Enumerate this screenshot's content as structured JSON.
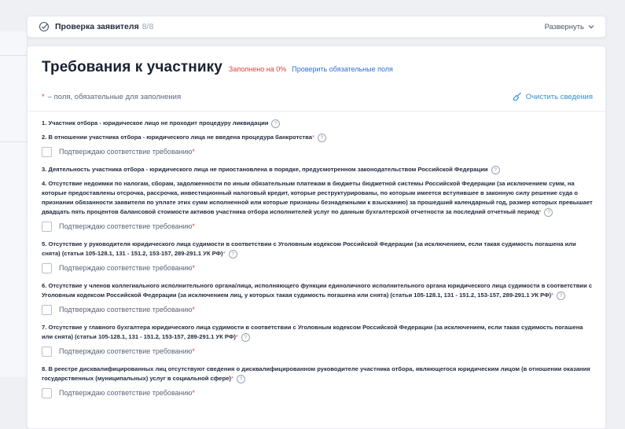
{
  "step": {
    "title": "Проверка заявителя",
    "count": "8/8",
    "expand_label": "Развернуть"
  },
  "section": {
    "title": "Требования к участнику",
    "fill_status": "Заполнено на 0%",
    "check_link": "Проверить обязательные поля"
  },
  "required_note": {
    "star": "*",
    "text": " – поля, обязательные для заполнения",
    "clear_label": "Очистить сведения"
  },
  "confirm_label": "Подтверждаю соответствие требованию",
  "requirements": [
    {
      "text": "1. Участник отбора - юридическое лицо не проходит процедуру ликвидации",
      "required": false,
      "confirm": false
    },
    {
      "text": "2. В отношении участника отбора - юридического лица не введена процедура банкротства",
      "required": true,
      "confirm": true
    },
    {
      "text": "3. Деятельность участника отбора - юридического лица не приостановлена в порядке, предусмотренном законодательством Российской Федерации",
      "required": false,
      "confirm": false
    },
    {
      "text": "4. Отсутствие недоимки по налогам, сборам, задолженности по иным обязательным платежам в бюджеты бюджетной системы Российской Федерации (за исключением сумм, на которые предоставлены отсрочка, рассрочка, инвестиционный налоговый кредит, которые реструктурированы, по которым имеется вступившее в законную силу решение суда о признании обязанности заявителя по уплате этих сумм исполненной или которые признаны безнадежными к взысканию) за прошедший календарный год, размер которых превышает двадцать пять процентов балансовой стоимости активов участника отбора исполнителей услуг по данным бухгалтерской отчетности за последний отчетный период",
      "required": true,
      "confirm": true
    },
    {
      "text": "5. Отсутствие у руководителя юридического лица судимости в соответствии с Уголовным кодексом Российской Федерации (за исключением, если такая судимость погашена или снята) (статьи 105-128.1, 131 - 151.2, 153-157, 289-291.1 УК РФ)",
      "required": true,
      "confirm": true
    },
    {
      "text": "6. Отсутствие у членов коллегиального исполнительного органа/лица, исполняющего функции единоличного исполнительного органа юридического лица судимости в соответствии с Уголовным кодексом Российской Федерации (за исключением лиц, у которых такая судимость погашена или снята) (статьи 105-128.1, 131 - 151.2, 153-157, 289-291.1 УК РФ)",
      "required": true,
      "confirm": true
    },
    {
      "text": "7. Отсутствие у главного бухгалтера юридического лица судимости в соответствии с Уголовным кодексом Российской Федерации (за исключением, если такая судимость погашена или снята) (статьи 105-128.1, 131 - 151.2, 153-157, 289-291.1 УК РФ)",
      "required": true,
      "confirm": true
    },
    {
      "text": "8. В реестре дисквалифицированных лиц отсутствуют сведения о дисквалифицированном руководителе участника отбора, являющегося юридическим лицом (в отношении оказания государственных (муниципальных) услуг в социальной сфере)",
      "required": true,
      "confirm": true
    }
  ],
  "colors": {
    "accent": "#2f6fd6",
    "danger": "#d9433b",
    "clear": "#2f8fd0"
  }
}
